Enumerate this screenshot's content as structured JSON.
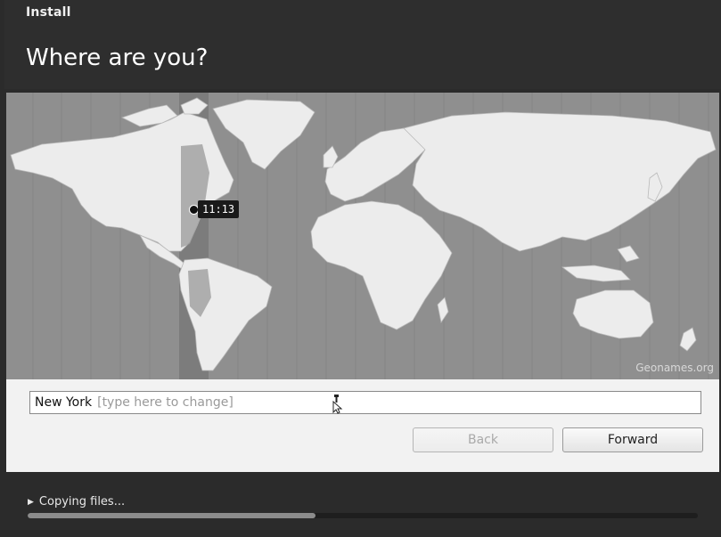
{
  "window": {
    "app_title": "Install",
    "page_title": "Where are you?"
  },
  "map": {
    "attribution": "Geonames.org",
    "time_tooltip": "11:13",
    "selected_city": "New York"
  },
  "timezone_input": {
    "value": "New York",
    "placeholder": "[type here to change]"
  },
  "buttons": {
    "back_label": "Back",
    "back_enabled": false,
    "forward_label": "Forward"
  },
  "progress": {
    "status_text": "Copying files...",
    "fraction": 0.43
  },
  "colors": {
    "ocean": "#8f8f8f",
    "land": "#ececec",
    "timezone_band": "#7a7a7a",
    "header_bg": "#2e2e2e",
    "content_bg": "#f2f2f2"
  }
}
